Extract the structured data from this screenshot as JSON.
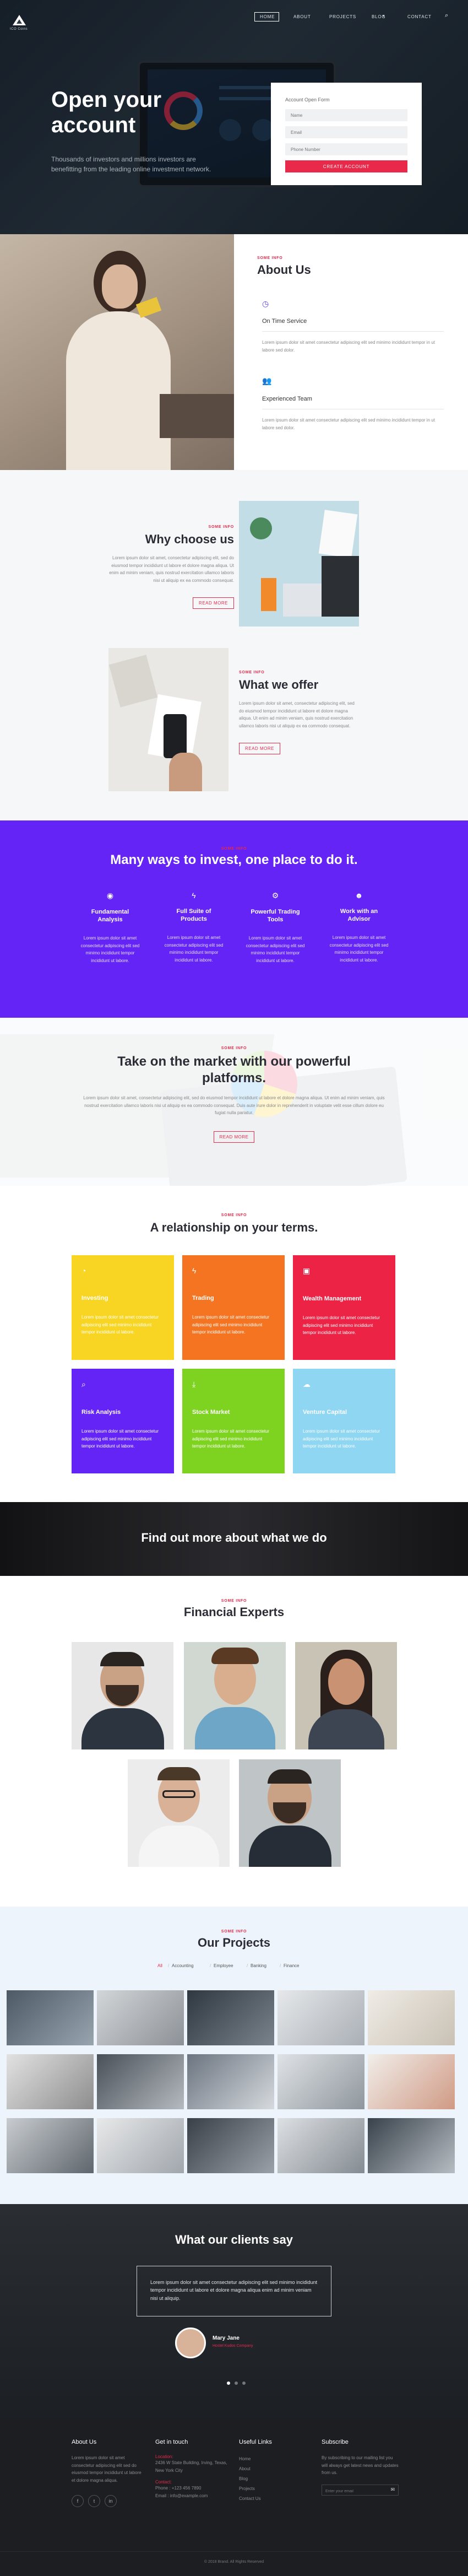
{
  "nav": {
    "logo_text": "ICO Coins",
    "items": [
      "HOME",
      "ABOUT",
      "PROJECTS",
      "BLOG",
      "CONTACT"
    ]
  },
  "hero": {
    "title_line1": "Open your",
    "title_line2": "account",
    "subtitle": "Thousands of investors and millions investors are benefitting from the leading online investment network.",
    "form": {
      "title": "Account Open Form",
      "name_placeholder": "Name",
      "email_placeholder": "Email",
      "phone_placeholder": "Phone Number",
      "submit": "CREATE ACCOUNT"
    }
  },
  "about": {
    "kicker": "SOME INFO",
    "title": "About Us",
    "item1_title": "On Time Service",
    "item1_text": "Lorem ipsum dolor sit amet consectetur adipiscing elit sed minimo incididunt tempor in ut labore sed dolor.",
    "item2_title": "Experienced Team",
    "item2_text": "Lorem ipsum dolor sit amet consectetur adipiscing elit sed minimo incididunt tempor in ut labore sed dolor."
  },
  "choose": {
    "kicker": "SOME INFO",
    "title": "Why choose us",
    "text": "Lorem ipsum dolor sit amet, consectetur adipiscing elit, sed do eiusmod tempor incididunt ut labore et dolore magna aliqua. Ut enim ad minim veniam, quis nostrud exercitation ullamco laboris nisi ut aliquip ex ea commodo consequat.",
    "button": "READ MORE"
  },
  "offer": {
    "kicker": "SOME INFO",
    "title": "What we offer",
    "text": "Lorem ipsum dolor sit amet, consectetur adipiscing elit, sed do eiusmod tempor incididunt ut labore et dolore magna aliqua. Ut enim ad minim veniam, quis nostrud exercitation ullamco laboris nisi ut aliquip ex ea commodo consequat.",
    "button": "READ MORE"
  },
  "invest": {
    "kicker": "SOME INFO",
    "title": "Many ways to invest, one place to do it.",
    "features": [
      {
        "icon": "globe-icon",
        "title_line1": "Fundamental",
        "title_line2": "Analysis",
        "text": "Lorem ipsum dolor sit amet consectetur adipiscing elit sed minimo incididunt tempor incididunt ut labore."
      },
      {
        "icon": "bolt-icon",
        "title_line1": "Full Suite of",
        "title_line2": "Products",
        "text": "Lorem ipsum dolor sit amet consectetur adipiscing elit sed minimo incididunt tempor incididunt ut labore."
      },
      {
        "icon": "gear-icon",
        "title_line1": "Powerful Trading",
        "title_line2": "Tools",
        "text": "Lorem ipsum dolor sit amet consectetur adipiscing elit sed minimo incididunt tempor incididunt ut labore."
      },
      {
        "icon": "user-icon",
        "title_line1": "Work with an",
        "title_line2": "Advisor",
        "text": "Lorem ipsum dolor sit amet consectetur adipiscing elit sed minimo incididunt tempor incididunt ut labore."
      }
    ]
  },
  "platform": {
    "kicker": "SOME INFO",
    "title_line1": "Take on the market with our powerful",
    "title_line2": "platforms.",
    "text": "Lorem ipsum dolor sit amet, consectetur adipiscing elit, sed do eiusmod tempor incididunt ut labore et dolore magna aliqua. Ut enim ad minim veniam, quis nostrud exercitation ullamco laboris nisi ut aliquip ex ea commodo consequat. Duis aute irure dolor in reprehenderit in voluptate velit esse cillum dolore eu fugiat nulla pariatur.",
    "button": "READ MORE"
  },
  "services": {
    "kicker": "SOME INFO",
    "title": "A relationship on your terms.",
    "cards": [
      {
        "title": "Investing",
        "icon": "chart-icon",
        "color": "#f8d523",
        "text": "Lorem ipsum dolor sit amet consectetur adipiscing elit sed minimo incididunt tempor incididunt ut labore."
      },
      {
        "title": "Trading",
        "icon": "bolt-icon",
        "color": "#f57422",
        "text": "Lorem ipsum dolor sit amet consectetur adipiscing elit sed minimo incididunt tempor incididunt ut labore."
      },
      {
        "title": "Wealth Management",
        "icon": "money-icon",
        "color": "#ec2345",
        "text": "Lorem ipsum dolor sit amet consectetur adipiscing elit sed minimo incididunt tempor incididunt ut labore."
      },
      {
        "title": "Risk Analysis",
        "icon": "search-icon",
        "color": "#6424f6",
        "text": "Lorem ipsum dolor sit amet consectetur adipiscing elit sed minimo incididunt tempor incididunt ut labore."
      },
      {
        "title": "Stock Market",
        "icon": "download-icon",
        "color": "#7ed320",
        "text": "Lorem ipsum dolor sit amet consectetur adipiscing elit sed minimo incididunt tempor incididunt ut labore."
      },
      {
        "title": "Venture Capital",
        "icon": "cloud-icon",
        "color": "#8ed6f2",
        "text": "Lorem ipsum dolor sit amet consectetur adipiscing elit sed minimo incididunt tempor incididunt ut labore."
      }
    ]
  },
  "cta": {
    "title": "Find out more about what we do"
  },
  "experts": {
    "kicker": "SOME INFO",
    "title": "Financial Experts"
  },
  "projects": {
    "kicker": "SOME INFO",
    "title": "Our Projects",
    "tabs": [
      "All",
      "Accounting",
      "Employee",
      "Banking",
      "Finance"
    ]
  },
  "testimonial": {
    "title": "What our clients say",
    "quote": "Lorem ipsum dolor sit amet consectetur adipiscing elit sed minimo incididunt tempor incididunt ut labore et dolore magna aliqua enim ad minim veniam nisi ut aliquip.",
    "name": "Mary Jane",
    "role": "Hostel Kudos Company"
  },
  "footer": {
    "about_title": "About Us",
    "about_text": "Lorem ipsum dolor sit amet consectetur adipiscing elit sed do eiusmod tempor incididunt ut labore et dolore magna aliqua.",
    "touch_title": "Get in touch",
    "location_label": "Location:",
    "location_text": "2436 W State Building, Irving, Texas, New York City",
    "contact_label": "Contact:",
    "phone": "Phone : +123 456 7890",
    "email": "Email : info@example.com",
    "links_title": "Useful Links",
    "links": [
      "Home",
      "About",
      "Blog",
      "Projects",
      "Contact Us"
    ],
    "subscribe_title": "Subscribe",
    "subscribe_text": "By subscribing to our mailing list you will always get latest news and updates from us.",
    "subscribe_placeholder": "Enter your email",
    "copyright": "© 2018 Brand. All Rights Reserved"
  }
}
